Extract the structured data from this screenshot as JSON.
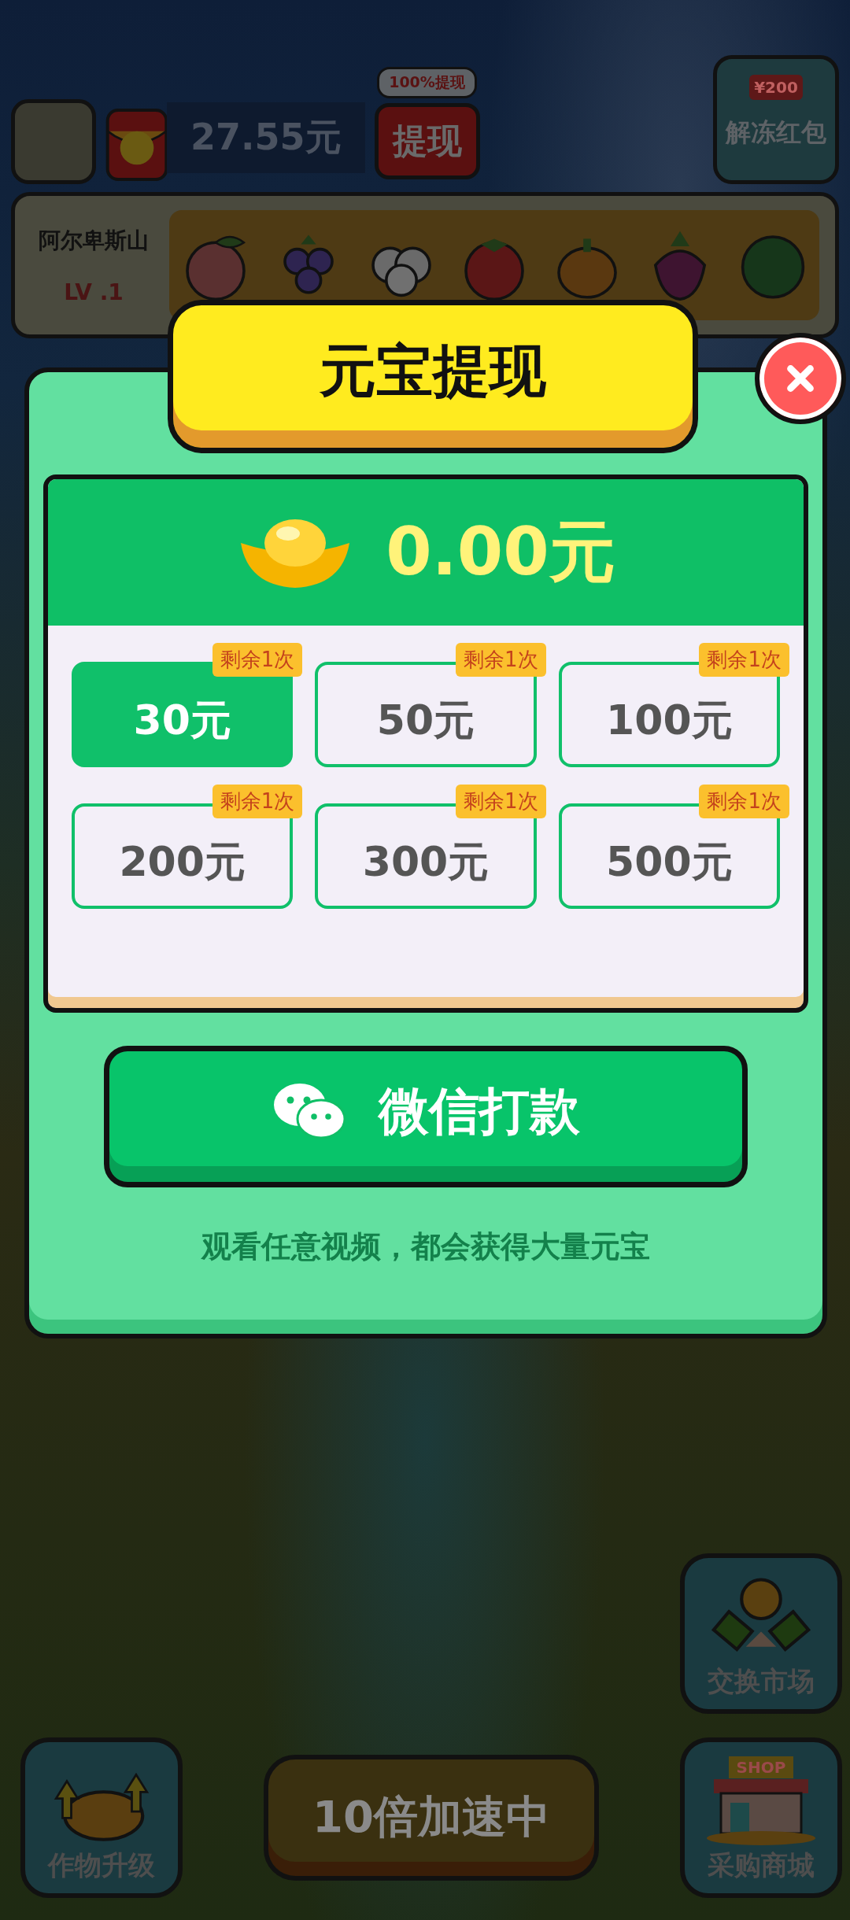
{
  "top_bar": {
    "balance": "27.55元",
    "withdraw_badge": "100%提现",
    "withdraw_button": "提现",
    "unfreeze_amount": "¥200",
    "unfreeze_button": "解冻红包"
  },
  "level_panel": {
    "name": "阿尔卑斯山",
    "level": "LV .1"
  },
  "dialog": {
    "title": "元宝提现",
    "balance": "0.00元",
    "options": [
      {
        "amount": "30元",
        "badge": "剩余1次",
        "selected": true
      },
      {
        "amount": "50元",
        "badge": "剩余1次",
        "selected": false
      },
      {
        "amount": "100元",
        "badge": "剩余1次",
        "selected": false
      },
      {
        "amount": "200元",
        "badge": "剩余1次",
        "selected": false
      },
      {
        "amount": "300元",
        "badge": "剩余1次",
        "selected": false
      },
      {
        "amount": "500元",
        "badge": "剩余1次",
        "selected": false
      }
    ],
    "pay_button": "微信打款",
    "notice": "观看任意视频，都会获得大量元宝"
  },
  "bottom": {
    "exchange_button": "交换市场",
    "upgrade_button": "作物升级",
    "speed_button": "10倍加速中",
    "shop_sign": "SHOP",
    "shop_button": "采购商城"
  }
}
